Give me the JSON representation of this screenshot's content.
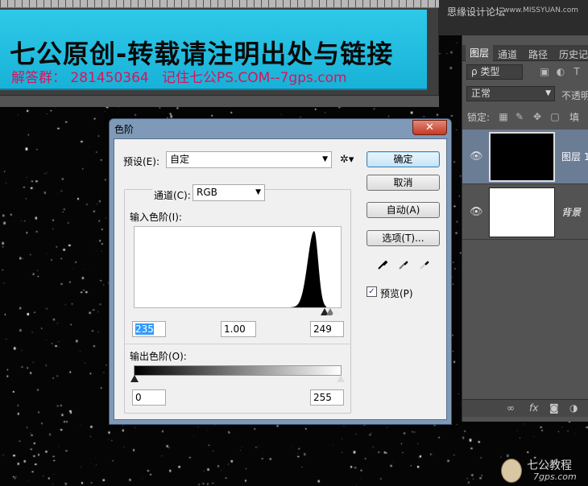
{
  "document": {
    "banner_title": "七公原创-转载请注明出处与链接",
    "banner_subtitle": "解答群： 281450364   记住七公PS.COM--7gps.com"
  },
  "watermark": {
    "text": "思缘设计论坛",
    "url": "www.MISSYUAN.com"
  },
  "layers_panel": {
    "tabs": [
      "图层",
      "通道",
      "路径",
      "历史记"
    ],
    "filter_label": "ρ 类型",
    "blend_mode": "正常",
    "opacity_label": "不透明",
    "lock_label": "锁定:",
    "fill_label": "填",
    "layers": [
      {
        "name": "图层 1",
        "thumbnail": "black",
        "selected": true
      },
      {
        "name": "背景",
        "thumbnail": "white",
        "selected": false
      }
    ],
    "footer_icons": [
      "link-icon",
      "fx-icon",
      "mask-icon",
      "adjustment-icon"
    ]
  },
  "dialog": {
    "title": "色阶",
    "close_label": "✕",
    "preset_label": "预设(E):",
    "preset_value": "自定",
    "channel_label": "通道(C):",
    "channel_value": "RGB",
    "input_levels_label": "输入色阶(I):",
    "input_black": "235",
    "input_gamma": "1.00",
    "input_white": "249",
    "output_levels_label": "输出色阶(O):",
    "output_black": "0",
    "output_white": "255",
    "buttons": {
      "ok": "确定",
      "cancel": "取消",
      "auto": "自动(A)",
      "options": "选项(T)..."
    },
    "preview_label": "预览(P)",
    "preview_checked": true
  },
  "histogram": {
    "range": [
      0,
      255
    ],
    "peak_level": 223,
    "shape": "single narrow peak near highlights"
  },
  "logo": {
    "text": "七公教程",
    "url": "7gps.com"
  }
}
